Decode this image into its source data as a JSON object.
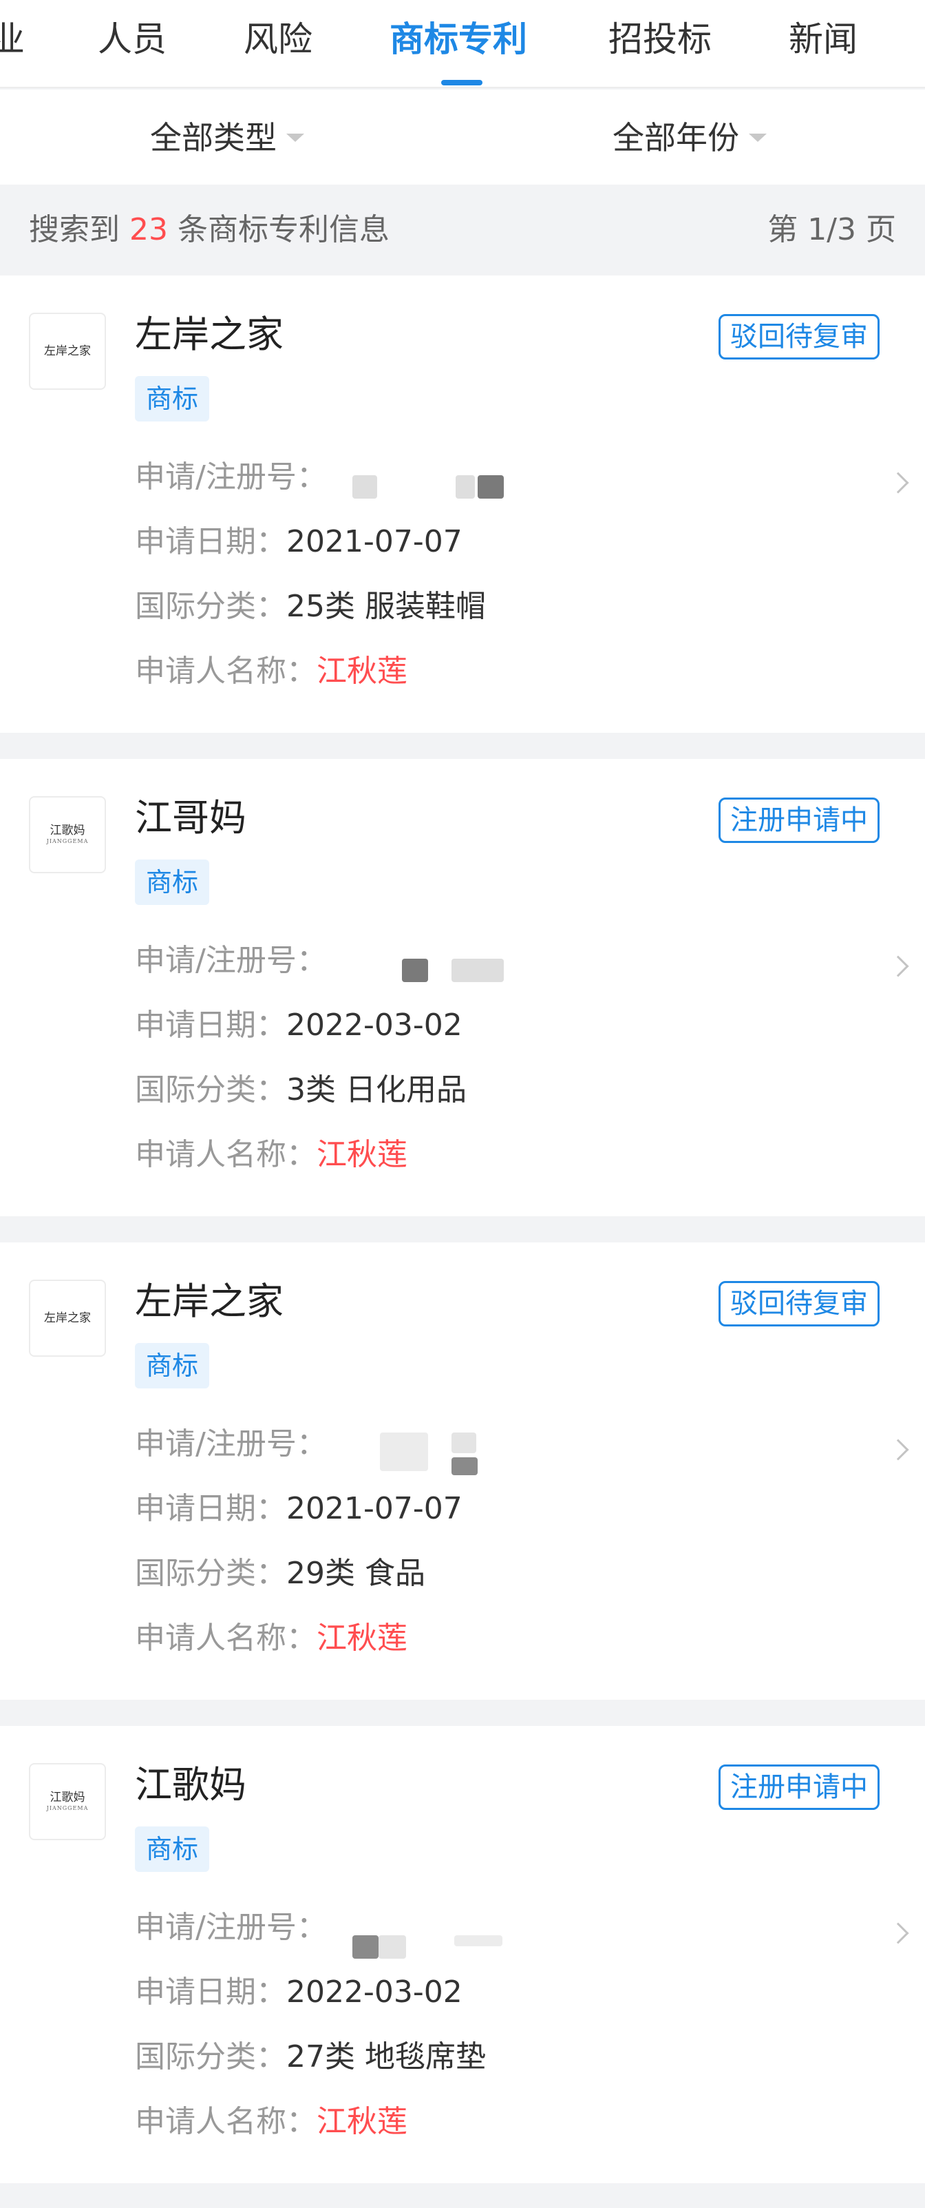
{
  "tabs": [
    {
      "label": "业"
    },
    {
      "label": "人员"
    },
    {
      "label": "风险"
    },
    {
      "label": "商标专利",
      "active": true
    },
    {
      "label": "招投标"
    },
    {
      "label": "新闻"
    }
  ],
  "filters": {
    "type": "全部类型",
    "year": "全部年份"
  },
  "summary": {
    "prefix": "搜索到",
    "count": "23",
    "suffix": "条商标专利信息",
    "page": "第 1/3 页"
  },
  "labels": {
    "reg_no": "申请/注册号：",
    "date": "申请日期：",
    "class": "国际分类：",
    "applicant": "申请人名称："
  },
  "colors": {
    "accent": "#1e88e5",
    "highlight": "#ff4d4f"
  },
  "cards": [
    {
      "logo_text": "左岸之家",
      "logo_sub": "",
      "name": "左岸之家",
      "status": "驳回待复审",
      "tag": "商标",
      "date": "2021-07-07",
      "class": "25类 服装鞋帽",
      "applicant": "江秋莲"
    },
    {
      "logo_text": "江歌妈",
      "logo_sub": "JIANGGEMA",
      "name": "江哥妈",
      "status": "注册申请中",
      "tag": "商标",
      "date": "2022-03-02",
      "class": "3类 日化用品",
      "applicant": "江秋莲"
    },
    {
      "logo_text": "左岸之家",
      "logo_sub": "",
      "name": "左岸之家",
      "status": "驳回待复审",
      "tag": "商标",
      "date": "2021-07-07",
      "class": "29类 食品",
      "applicant": "江秋莲"
    },
    {
      "logo_text": "江歌妈",
      "logo_sub": "JIANGGEMA",
      "name": "江歌妈",
      "status": "注册申请中",
      "tag": "商标",
      "date": "2022-03-02",
      "class": "27类 地毯席垫",
      "applicant": "江秋莲"
    }
  ]
}
